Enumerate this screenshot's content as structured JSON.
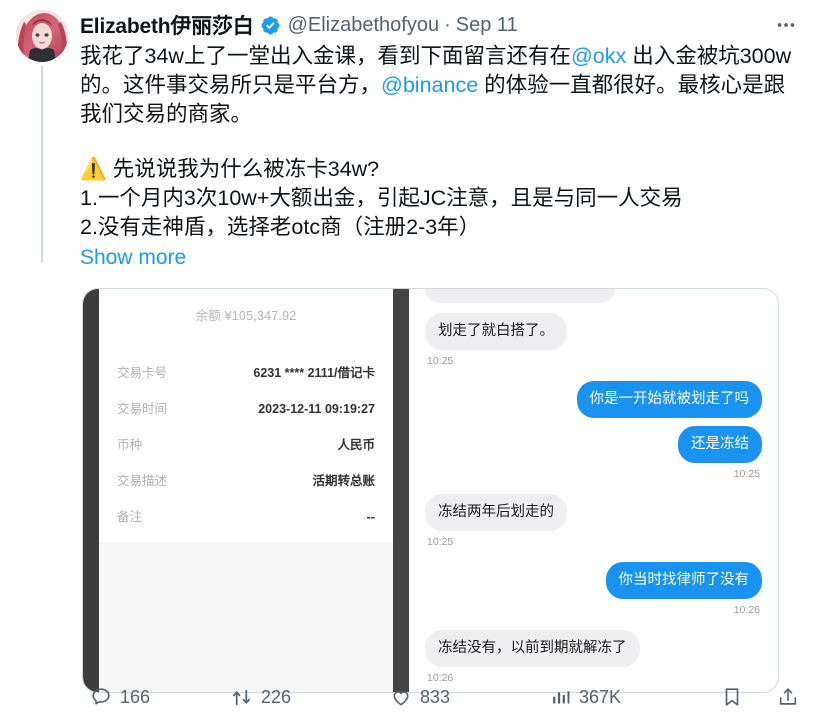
{
  "post": {
    "display_name": "Elizabeth伊丽莎白",
    "handle": "@Elizabethofyou",
    "separator": "·",
    "date": "Sep 11",
    "verified_icon": "verified-badge-icon",
    "more_icon": "more-options-icon",
    "avatar_alt": "avatar",
    "text": {
      "p1_a": "我花了34w上了一堂出入金课，看到下面留言还有在",
      "p1_link1": "@okx",
      "p1_b": " 出入金被坑300w的。这件事交易所只是平台方，",
      "p1_link2": "@binance",
      "p1_c": " 的体验一直都很好。最核心是跟我们交易的商家。",
      "p2_l1": "⚠️ 先说说我为什么被冻卡34w?",
      "p2_l2": "1.一个月内3次10w+大额出金，引起JC注意，且是与同一人交易",
      "p2_l3": "2.没有走神盾，选择老otc商（注册2-3年）"
    },
    "show_more": "Show more"
  },
  "media": {
    "statement": {
      "balance": "余额 ¥105,347.92",
      "rows": [
        {
          "label": "交易卡号",
          "value": "6231 **** 2111/借记卡"
        },
        {
          "label": "交易时间",
          "value": "2023-12-11 09:19:27"
        },
        {
          "label": "币种",
          "value": "人民币"
        },
        {
          "label": "交易描述",
          "value": "活期转总账"
        },
        {
          "label": "备注",
          "value": "--"
        }
      ]
    },
    "chat": {
      "messages": [
        {
          "side": "in",
          "text": "划走了就白搭了。",
          "time": "10:25"
        },
        {
          "side": "out",
          "text": "你是一开始就被划走了吗",
          "time": ""
        },
        {
          "side": "out",
          "text": "还是冻结",
          "time": "10:25"
        },
        {
          "side": "in",
          "text": "冻结两年后划走的",
          "time": "10:25"
        },
        {
          "side": "out",
          "text": "你当时找律师了没有",
          "time": "10:26"
        },
        {
          "side": "in",
          "text": "冻结没有，以前到期就解冻了",
          "time": "10:26"
        }
      ]
    }
  },
  "actions": {
    "reply": {
      "icon": "reply-icon",
      "count": "166"
    },
    "retweet": {
      "icon": "retweet-icon",
      "count": "226"
    },
    "like": {
      "icon": "like-icon",
      "count": "833"
    },
    "views": {
      "icon": "views-icon",
      "count": "367K"
    },
    "bookmark": {
      "icon": "bookmark-icon"
    },
    "share": {
      "icon": "share-icon"
    }
  },
  "colors": {
    "link": "#1d9bf0",
    "text": "#0f1419",
    "muted": "#536471",
    "bubble_out": "#1a93f0",
    "bubble_in": "#efeff1"
  }
}
